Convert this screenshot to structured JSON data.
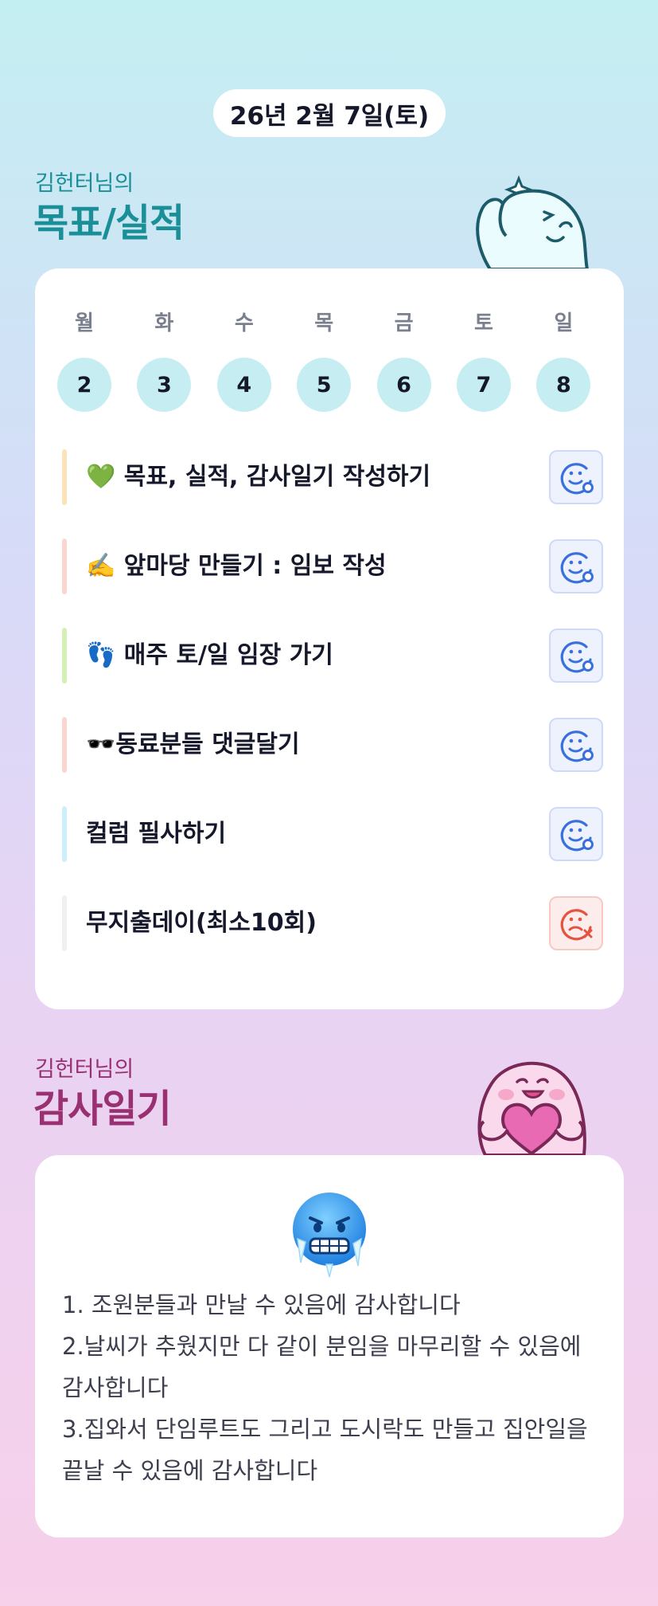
{
  "header": {
    "date": "26년 2월 7일(토)"
  },
  "goals": {
    "owner": "김헌터님의",
    "title": "목표/실적",
    "week": {
      "weekdays": [
        "월",
        "화",
        "수",
        "목",
        "금",
        "토",
        "일"
      ],
      "dates": [
        "2",
        "3",
        "4",
        "5",
        "6",
        "7",
        "8"
      ]
    },
    "tasks": [
      {
        "label": "💚 목표, 실적, 감사일기 작성하기",
        "bar_color": "#fbe3b9",
        "status": "done-icon"
      },
      {
        "label": "✍️ 앞마당 만들기 : 임보 작성",
        "bar_color": "#fbd6d0",
        "status": "done-icon"
      },
      {
        "label": "👣 매주 토/일 임장 가기",
        "bar_color": "#d4f0b6",
        "status": "done-icon"
      },
      {
        "label": "🕶️동료분들 댓글달기",
        "bar_color": "#fbd6d0",
        "status": "done-icon"
      },
      {
        "label": "컬럼 필사하기",
        "bar_color": "#cdeefb",
        "status": "done-icon"
      },
      {
        "label": "무지출데이(최소10회)",
        "bar_color": "#f0f0f0",
        "status": "fail-icon"
      }
    ]
  },
  "gratitude": {
    "owner": "김헌터님의",
    "title": "감사일기",
    "emoji": "cold-face-icon",
    "text": "1. 조원분들과 만날 수 있음에 감사합니다\n2.날씨가 추웠지만 다 같이 분임을 마무리할 수 있음에 감사합니다\n3.집와서 단임루트도 그리고 도시락도 만들고 집안일을 끝날 수 있음에 감사합니다"
  }
}
